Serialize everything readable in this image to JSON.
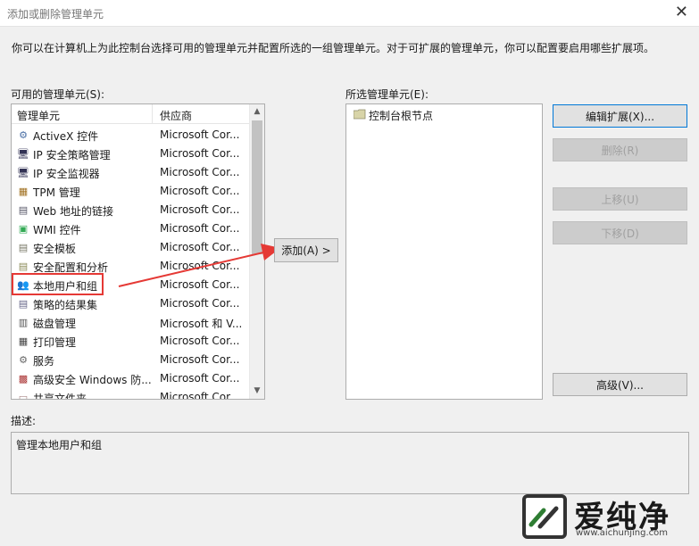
{
  "window": {
    "title": "添加或删除管理单元"
  },
  "intro": "你可以在计算机上为此控制台选择可用的管理单元并配置所选的一组管理单元。对于可扩展的管理单元，你可以配置要启用哪些扩展项。",
  "available": {
    "label": "可用的管理单元(S):",
    "col_name": "管理单元",
    "col_vendor": "供应商",
    "items": [
      {
        "name": "ActiveX 控件",
        "vendor": "Microsoft Cor...",
        "icon": "activex-icon"
      },
      {
        "name": "IP 安全策略管理",
        "vendor": "Microsoft Cor...",
        "icon": "ip-policy-icon"
      },
      {
        "name": "IP 安全监视器",
        "vendor": "Microsoft Cor...",
        "icon": "ip-monitor-icon"
      },
      {
        "name": "TPM 管理",
        "vendor": "Microsoft Cor...",
        "icon": "tpm-icon"
      },
      {
        "name": "Web 地址的链接",
        "vendor": "Microsoft Cor...",
        "icon": "web-link-icon"
      },
      {
        "name": "WMI 控件",
        "vendor": "Microsoft Cor...",
        "icon": "wmi-icon"
      },
      {
        "name": "安全模板",
        "vendor": "Microsoft Cor...",
        "icon": "security-template-icon"
      },
      {
        "name": "安全配置和分析",
        "vendor": "Microsoft Cor...",
        "icon": "security-config-icon"
      },
      {
        "name": "本地用户和组",
        "vendor": "Microsoft Cor...",
        "icon": "local-users-icon"
      },
      {
        "name": "策略的结果集",
        "vendor": "Microsoft Cor...",
        "icon": "rsop-icon"
      },
      {
        "name": "磁盘管理",
        "vendor": "Microsoft 和 V...",
        "icon": "disk-icon"
      },
      {
        "name": "打印管理",
        "vendor": "Microsoft Cor...",
        "icon": "printer-icon"
      },
      {
        "name": "服务",
        "vendor": "Microsoft Cor...",
        "icon": "services-icon"
      },
      {
        "name": "高级安全 Windows 防...",
        "vendor": "Microsoft Cor...",
        "icon": "firewall-icon"
      },
      {
        "name": "共享文件夹",
        "vendor": "Microsoft Cor...",
        "icon": "shared-folder-icon"
      }
    ]
  },
  "add_button": "添加(A) >",
  "selected": {
    "label": "所选管理单元(E):",
    "root": "控制台根节点"
  },
  "buttons": {
    "edit_ext": "编辑扩展(X)...",
    "remove": "删除(R)",
    "move_up": "上移(U)",
    "move_down": "下移(D)",
    "advanced": "高级(V)..."
  },
  "description": {
    "label": "描述:",
    "text": "管理本地用户和组"
  },
  "watermark": {
    "title": "爱纯净",
    "url": "www.aichunjing.com"
  },
  "colors": {
    "accent": "#0078d7",
    "highlight": "#e53935"
  }
}
